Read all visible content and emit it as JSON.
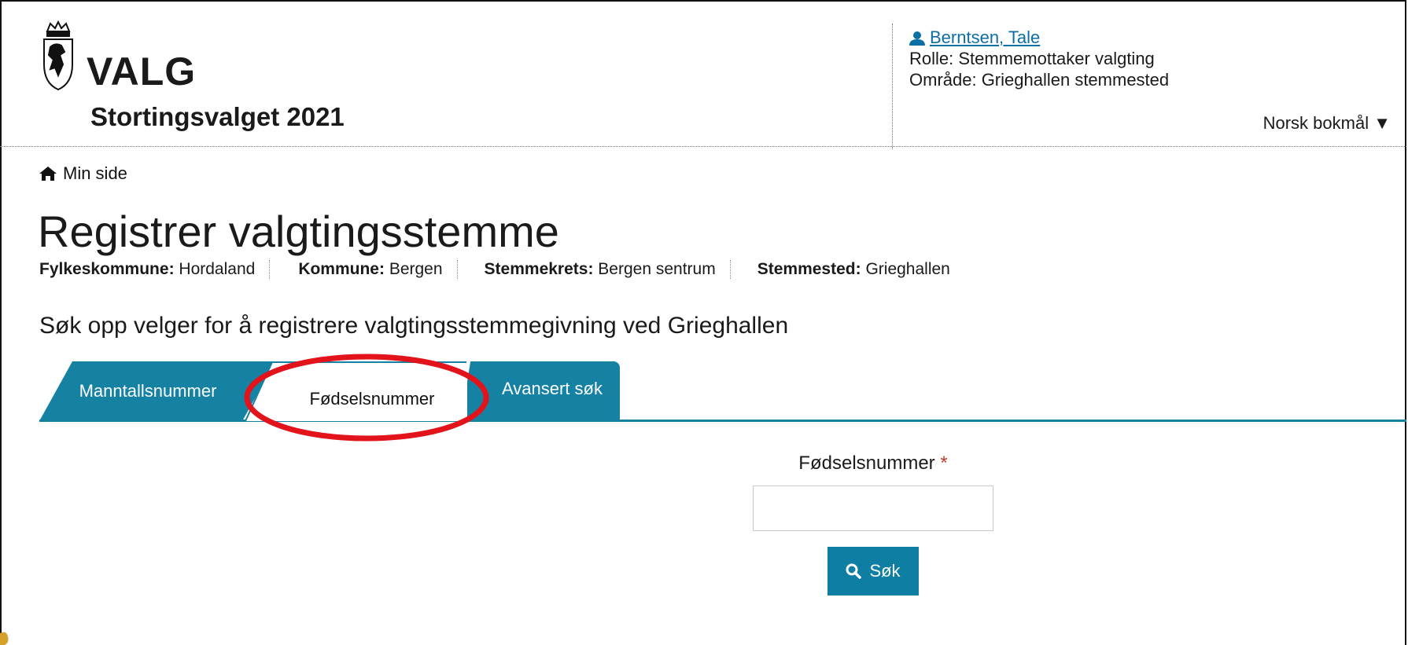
{
  "header": {
    "brand": "VALG",
    "election": "Stortingsvalget 2021",
    "user_name": "Berntsen, Tale",
    "role": "Rolle: Stemmemottaker valgting",
    "area": "Område: Grieghallen stemmested",
    "language": "Norsk bokmål"
  },
  "breadcrumb": {
    "home": "Min side"
  },
  "page": {
    "title": "Registrer valgtingsstemme",
    "meta": [
      {
        "label": "Fylkeskommune:",
        "value": "Hordaland"
      },
      {
        "label": "Kommune:",
        "value": "Bergen"
      },
      {
        "label": "Stemmekrets:",
        "value": "Bergen sentrum"
      },
      {
        "label": "Stemmested:",
        "value": "Grieghallen"
      }
    ],
    "lead": "Søk opp velger for å registrere valgtingsstemmegivning ved Grieghallen"
  },
  "tabs": [
    {
      "label": "Manntallsnummer",
      "active": false
    },
    {
      "label": "Fødselsnummer",
      "active": true
    },
    {
      "label": "Avansert søk",
      "active": false
    }
  ],
  "form": {
    "field_label": "Fødselsnummer",
    "required_mark": "*",
    "value": "",
    "placeholder": "",
    "submit_label": "Søk"
  },
  "icons": {
    "home": "home-icon",
    "user": "user-icon",
    "dropdown": "caret-down-icon",
    "search": "search-icon",
    "logo": "coat-of-arms-icon"
  },
  "colors": {
    "accent": "#1582a4",
    "link": "#0b6fa4",
    "annotation": "#e3131b",
    "required": "#c0392b"
  }
}
